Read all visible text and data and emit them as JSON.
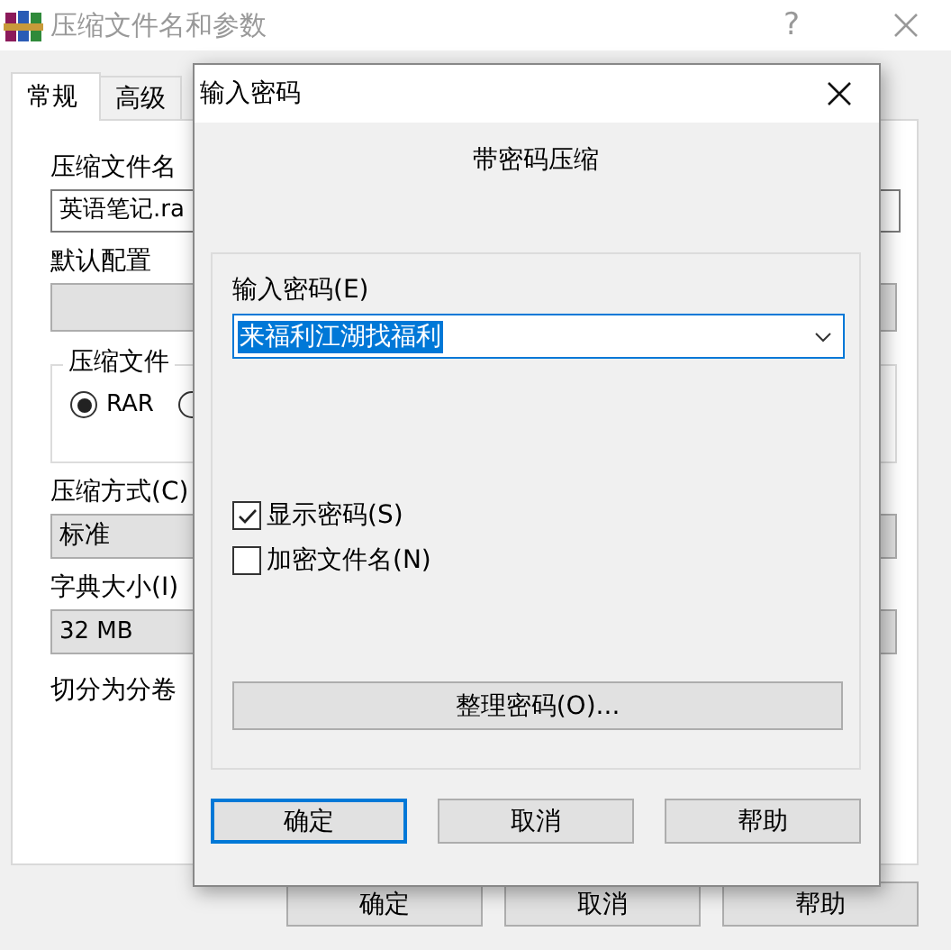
{
  "window": {
    "title": "压缩文件名和参数",
    "help_glyph": "?"
  },
  "tabs": [
    {
      "label": "常规",
      "selected": true
    },
    {
      "label": "高级",
      "selected": false
    }
  ],
  "general": {
    "archive_name_label": "压缩文件名",
    "archive_name_value": "英语笔记.ra",
    "default_profile_label": "默认配置",
    "format_group_label": "压缩文件",
    "formats": [
      {
        "label": "RAR",
        "selected": true
      },
      {
        "selected": false
      }
    ],
    "method_label": "压缩方式(C)",
    "method_value": "标准",
    "dictionary_label": "字典大小(I)",
    "dictionary_value": "32 MB",
    "split_label": "切分为分卷"
  },
  "buttons": [
    "确定",
    "取消",
    "帮助"
  ],
  "password_dialog": {
    "title": "输入密码",
    "heading": "带密码压缩",
    "password_label": "输入密码(E)",
    "password_value": "来福利江湖找福利",
    "password_selected": true,
    "options": [
      {
        "label": "显示密码(S)",
        "checked": true
      },
      {
        "label": "加密文件名(N)",
        "checked": false
      }
    ],
    "organize_button": "整理密码(O)...",
    "buttons": [
      {
        "label": "确定",
        "default": true
      },
      {
        "label": "取消",
        "default": false
      },
      {
        "label": "帮助",
        "default": false
      }
    ]
  }
}
